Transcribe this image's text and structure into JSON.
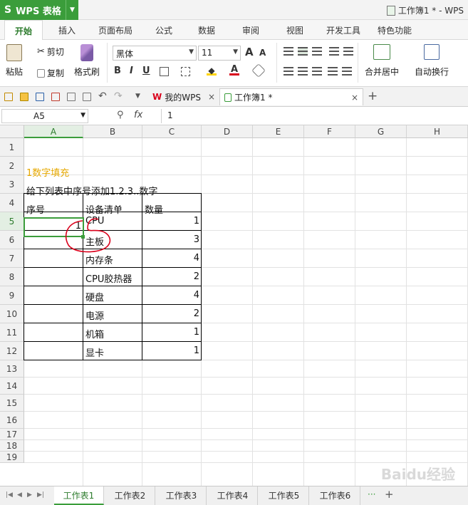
{
  "app": {
    "logo": "S",
    "name": "WPS 表格"
  },
  "window": {
    "title": "工作簿1 * - WPS"
  },
  "ribbon_tabs": [
    "开始",
    "插入",
    "页面布局",
    "公式",
    "数据",
    "审阅",
    "视图",
    "开发工具",
    "特色功能"
  ],
  "ribbon": {
    "paste": "粘贴",
    "cut": "剪切",
    "copy": "复制",
    "format_painter": "格式刷",
    "font_name": "黑体",
    "font_size": "11",
    "bold": "B",
    "italic": "I",
    "underline": "U",
    "merge_center": "合并居中",
    "wrap_text": "自动换行",
    "increase_font": "A",
    "decrease_font": "A"
  },
  "doc_tabs": [
    {
      "label": "我的WPS",
      "close": "×"
    },
    {
      "label": "工作簿1 *",
      "close": "×"
    }
  ],
  "new_tab": "+",
  "formula_bar": {
    "name_box": "A5",
    "fx": "fx",
    "value": "1"
  },
  "columns": [
    "A",
    "B",
    "C",
    "D",
    "E",
    "F",
    "G",
    "H"
  ],
  "rows": [
    "1",
    "2",
    "3",
    "4",
    "5",
    "6",
    "7",
    "8",
    "9",
    "10",
    "11",
    "12",
    "13",
    "14",
    "15",
    "16",
    "17",
    "18",
    "19"
  ],
  "sheet": {
    "heading": "1数字填充",
    "instruction": "给下列表中序号添加1.2.3..数字",
    "headers": [
      "序号",
      "设备清单",
      "数量"
    ],
    "serial_first": "1",
    "items": [
      {
        "name": "CPU",
        "qty": "1"
      },
      {
        "name": "主板",
        "qty": "3"
      },
      {
        "name": "内存条",
        "qty": "4"
      },
      {
        "name": "CPU胶热器",
        "qty": "2"
      },
      {
        "name": "硬盘",
        "qty": "4"
      },
      {
        "name": "电源",
        "qty": "2"
      },
      {
        "name": "机箱",
        "qty": "1"
      },
      {
        "name": "显卡",
        "qty": "1"
      }
    ]
  },
  "sheet_tabs": [
    "工作表1",
    "工作表2",
    "工作表3",
    "工作表4",
    "工作表5",
    "工作表6"
  ],
  "watermark": "Baidu经验",
  "colors": {
    "accent": "#3b9d3b",
    "heading": "#e6a800",
    "annotation": "#d9001b"
  }
}
